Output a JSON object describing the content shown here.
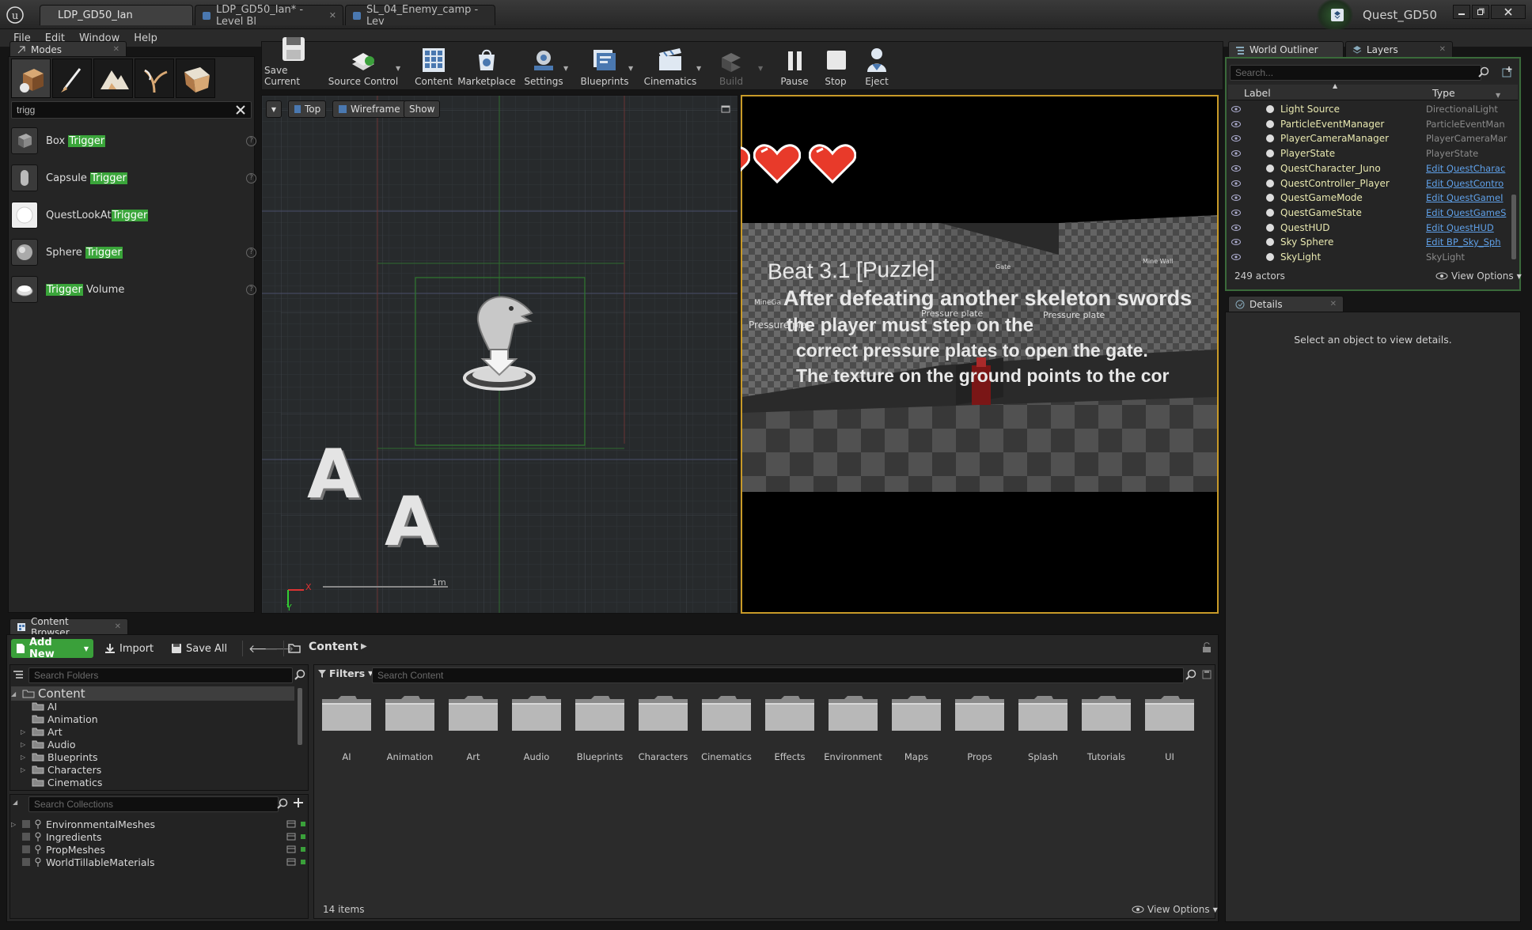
{
  "window": {
    "tabs": [
      {
        "label": "LDP_GD50_Ian"
      },
      {
        "label": "LDP_GD50_Ian* - Level Bl"
      },
      {
        "label": "SL_04_Enemy_camp - Lev"
      }
    ],
    "project_name": "Quest_GD50"
  },
  "menu": [
    "File",
    "Edit",
    "Window",
    "Help"
  ],
  "modes": {
    "tab_label": "Modes",
    "search_value": "trigg",
    "items": [
      {
        "pre": "Box ",
        "hl": "Trigger",
        "post": ""
      },
      {
        "pre": "Capsule ",
        "hl": "Trigger",
        "post": ""
      },
      {
        "pre": "QuestLookAt",
        "hl": "Trigger",
        "post": ""
      },
      {
        "pre": "Sphere ",
        "hl": "Trigger",
        "post": ""
      },
      {
        "pre": "",
        "hl": "Trigger",
        "post": " Volume"
      }
    ]
  },
  "toolbar": {
    "save_current": "Save Current",
    "source_control": "Source Control",
    "content": "Content",
    "marketplace": "Marketplace",
    "settings": "Settings",
    "blueprints": "Blueprints",
    "cinematics": "Cinematics",
    "build": "Build",
    "pause": "Pause",
    "stop": "Stop",
    "eject": "Eject"
  },
  "viewport": {
    "view_mode": "Top",
    "render_mode": "Wireframe",
    "show": "Show",
    "scale_label": "1m",
    "axis_x": "X",
    "axis_y": "Y",
    "letter_a": "A"
  },
  "game_view": {
    "beat_title": "Beat 3.1 [Puzzle]",
    "lines": [
      "After defeating another skeleton swords",
      "the player must step on the",
      "correct pressure plates to open the gate.",
      "The texture on the ground points to the cor"
    ],
    "world_labels": [
      "Gate",
      "Mine Wall",
      "Pressure plate",
      "Pressure plate",
      "Pressure plat",
      "MineGa"
    ],
    "hearts": 2
  },
  "outliner": {
    "tab_label": "World Outliner",
    "layers_tab": "Layers",
    "search_placeholder": "Search...",
    "col_label": "Label",
    "col_type": "Type",
    "rows": [
      {
        "label": "Light Source",
        "type": "DirectionalLight",
        "link": false
      },
      {
        "label": "ParticleEventManager",
        "type": "ParticleEventMan",
        "link": false
      },
      {
        "label": "PlayerCameraManager",
        "type": "PlayerCameraMar",
        "link": false
      },
      {
        "label": "PlayerState",
        "type": "PlayerState",
        "link": false
      },
      {
        "label": "QuestCharacter_Juno",
        "type": "Edit QuestCharac",
        "link": true
      },
      {
        "label": "QuestController_Player",
        "type": "Edit QuestContro",
        "link": true
      },
      {
        "label": "QuestGameMode",
        "type": "Edit QuestGameI",
        "link": true
      },
      {
        "label": "QuestGameState",
        "type": "Edit QuestGameS",
        "link": true
      },
      {
        "label": "QuestHUD",
        "type": "Edit QuestHUD",
        "link": true
      },
      {
        "label": "Sky Sphere",
        "type": "Edit BP_Sky_Sph",
        "link": true
      },
      {
        "label": "SkyLight",
        "type": "SkyLight",
        "link": false
      }
    ],
    "actor_count": "249 actors",
    "view_options": "View Options"
  },
  "details": {
    "tab_label": "Details",
    "empty_message": "Select an object to view details."
  },
  "content_browser": {
    "tab_label": "Content Browser",
    "add_new": "Add New",
    "import": "Import",
    "save_all": "Save All",
    "path": "Content",
    "search_folders_placeholder": "Search Folders",
    "filters": "Filters",
    "search_content_placeholder": "Search Content",
    "tree": [
      {
        "label": "Content",
        "indent": 0,
        "expander": true
      },
      {
        "label": "AI",
        "indent": 1,
        "expander": false
      },
      {
        "label": "Animation",
        "indent": 1,
        "expander": false
      },
      {
        "label": "Art",
        "indent": 1,
        "expander": true
      },
      {
        "label": "Audio",
        "indent": 1,
        "expander": true
      },
      {
        "label": "Blueprints",
        "indent": 1,
        "expander": true
      },
      {
        "label": "Characters",
        "indent": 1,
        "expander": true
      },
      {
        "label": "Cinematics",
        "indent": 1,
        "expander": false
      }
    ],
    "search_collections_placeholder": "Search Collections",
    "collections": [
      "EnvironmentalMeshes",
      "Ingredients",
      "PropMeshes",
      "WorldTillableMaterials"
    ],
    "folders": [
      "AI",
      "Animation",
      "Art",
      "Audio",
      "Blueprints",
      "Characters",
      "Cinematics",
      "Effects",
      "Environment",
      "Maps",
      "Props",
      "Splash",
      "Tutorials",
      "UI"
    ],
    "item_count": "14 items",
    "view_options": "View Options"
  }
}
